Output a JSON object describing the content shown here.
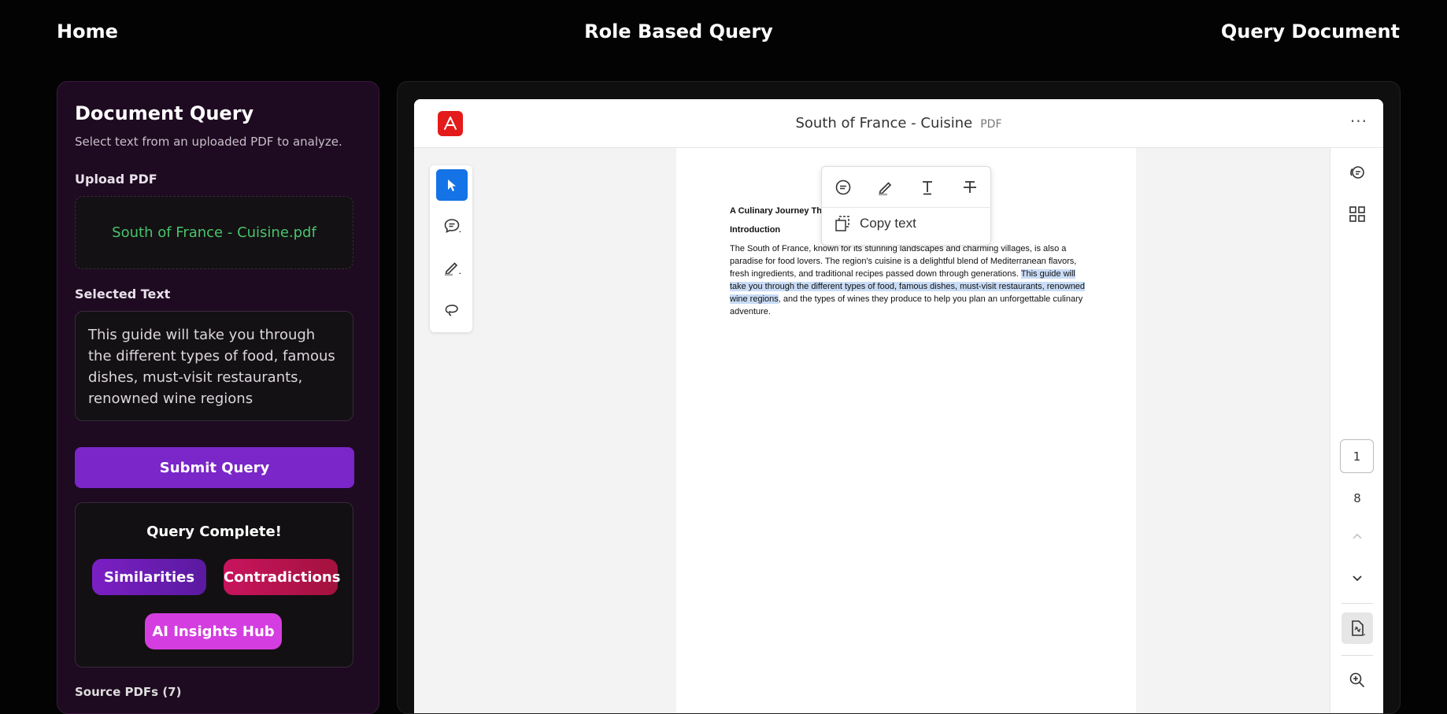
{
  "nav": {
    "home": "Home",
    "role_based": "Role Based Query",
    "query_document": "Query Document"
  },
  "left_panel": {
    "title": "Document Query",
    "subtitle": "Select text from an uploaded PDF to analyze.",
    "upload_label": "Upload PDF",
    "uploaded_file": "South of France - Cuisine.pdf",
    "selected_label": "Selected Text",
    "selected_text": "This guide will take you through the different types of food, famous dishes, must-visit restaurants, renowned wine regions",
    "submit_label": "Submit Query",
    "result": {
      "title": "Query Complete!",
      "similarities": "Similarities",
      "contradictions": "Contradictions",
      "insights": "AI Insights Hub"
    },
    "sources_label": "Source PDFs (7)"
  },
  "viewer": {
    "doc_title": "South of France - Cuisine",
    "doc_type": "PDF",
    "more": "···",
    "page": {
      "heading": "A Culinary Journey Thro",
      "intro": "Introduction",
      "line1": "The South of France, known for its stunning landscapes and charming villages, is also a",
      "line2": "paradise for food lovers. The region's cuisine is a delightful blend of Mediterranean flavors,",
      "line3_plain": "fresh ingredients, and traditional recipes passed down through generations. ",
      "line3_hl": "This guide will",
      "line4_hl": "take you through the different types of food, famous dishes, must-visit restaurants, renowned",
      "line5_hl": "wine regions",
      "line5_plain": ", and the types of wines they produce to help you plan an unforgettable culinary",
      "line6": "adventure."
    },
    "popup": {
      "copy_text": "Copy text"
    },
    "current_page": "1",
    "total_pages": "8"
  },
  "colors": {
    "accent_purple": "#7a26c8",
    "contradiction_red": "#c8145e",
    "insights_pink": "#d43ee0",
    "file_green": "#49c36c",
    "acrobat_red": "#e31b1b",
    "tool_active_blue": "#1473e6",
    "highlight": "#c9dcf6"
  }
}
